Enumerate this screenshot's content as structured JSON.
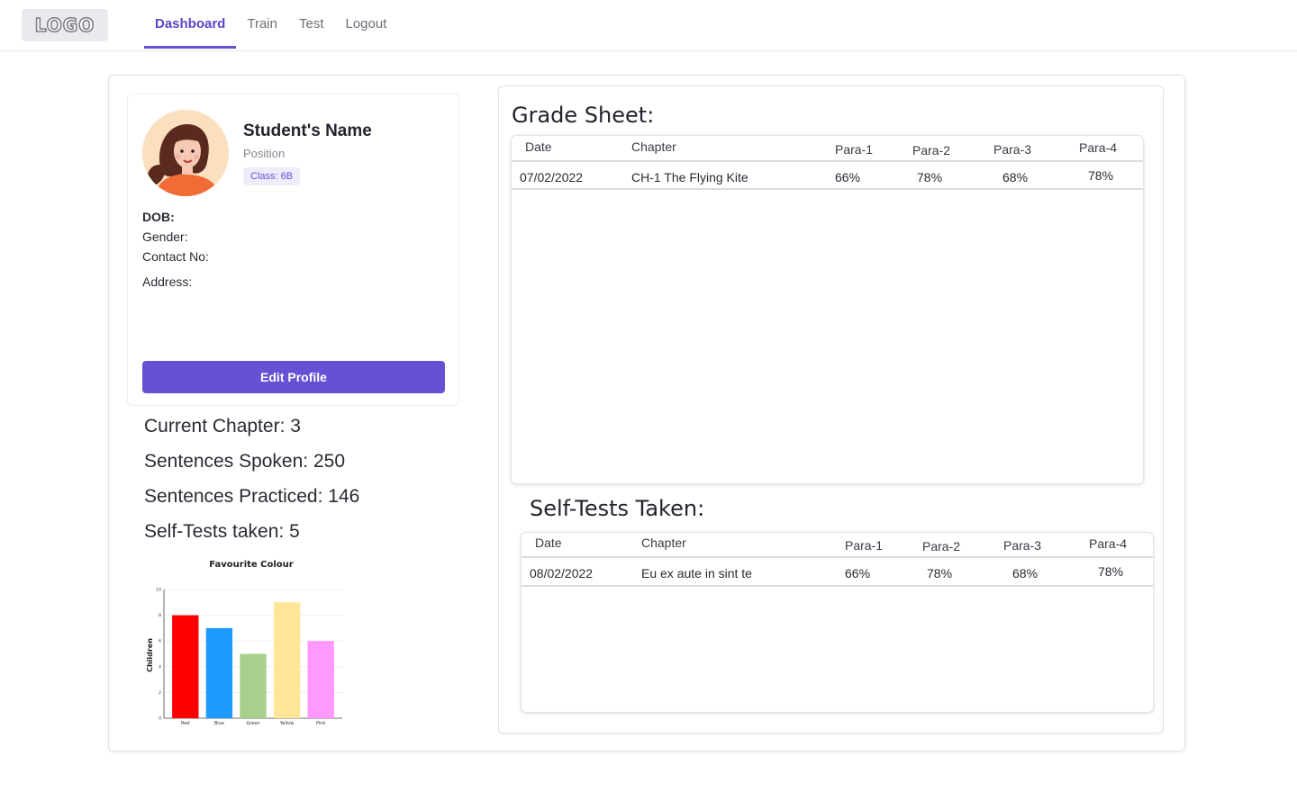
{
  "nav": {
    "logo": "LOGO",
    "items": [
      {
        "label": "Dashboard",
        "active": true
      },
      {
        "label": "Train",
        "active": false
      },
      {
        "label": "Test",
        "active": false
      },
      {
        "label": "Logout",
        "active": false
      }
    ]
  },
  "profile": {
    "name": "Student's Name",
    "position": "Position",
    "class_badge": "Class: 6B",
    "dob_label": "DOB:",
    "gender_label": "Gender:",
    "contact_label": "Contact No:",
    "address_label": "Address:",
    "edit_button": "Edit Profile"
  },
  "stats": {
    "current_chapter": "Current Chapter: 3",
    "sentences_spoken": "Sentences Spoken: 250",
    "sentences_practiced": "Sentences Practiced: 146",
    "self_tests_taken": "Self-Tests taken: 5"
  },
  "chart_data": {
    "type": "bar",
    "title": "Favourite Colour",
    "ylabel": "Children",
    "xlabel": "",
    "categories": [
      "Red",
      "Blue",
      "Green",
      "Yellow",
      "Pink"
    ],
    "values": [
      8,
      7,
      5,
      9,
      6
    ],
    "colors": [
      "#ff0000",
      "#1e9bff",
      "#a8d08d",
      "#ffe699",
      "#ff99ff"
    ],
    "ylim": [
      0,
      10
    ],
    "yticks": [
      "0",
      "2",
      "4",
      "6",
      "8",
      "10"
    ],
    "grid": true
  },
  "grade_sheet": {
    "title": "Grade Sheet:",
    "headers": [
      "Date",
      "Chapter",
      "Para-1",
      "Para-2",
      "Para-3",
      "Para-4"
    ],
    "rows": [
      [
        "07/02/2022",
        "CH-1 The Flying Kite",
        "66%",
        "78%",
        "68%",
        "78%"
      ]
    ]
  },
  "self_tests": {
    "title": "Self-Tests Taken:",
    "headers": [
      "Date",
      "Chapter",
      "Para-1",
      "Para-2",
      "Para-3",
      "Para-4"
    ],
    "rows": [
      [
        "08/02/2022",
        "Eu ex aute in sint te",
        "66%",
        "78%",
        "68%",
        "78%"
      ]
    ]
  },
  "colors": {
    "accent": "#6650d4",
    "badge_bg": "#efedfb"
  }
}
